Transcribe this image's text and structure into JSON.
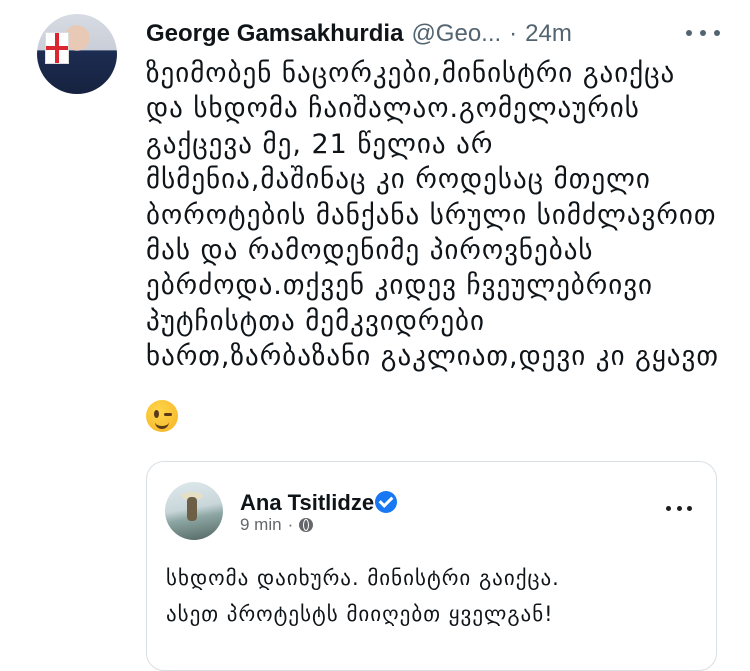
{
  "tweet": {
    "author_name": "George Gamsakhurdia",
    "handle": "@Geo...",
    "separator": "·",
    "time": "24m",
    "text_lines": [
      "ზეიმობენ ნაცორკები,მინისტრი გაიქცა",
      "და სხდომა ჩაიშალაო.გომელაურის",
      "გაქცევა მე, 21 წელია არ",
      "მსმენია,მაშინაც კი როდესაც მთელი",
      "ბოროტების მანქანა სრული სიმძლავრით",
      "მას და რამოდენიმე პიროვნებას",
      "ებრძოდა.თქვენ კიდევ ჩვეულებრივი",
      "პუტჩისტთა მემკვიდრები",
      "ხართ,ზარბაზანი გაკლიათ,დევი კი გყავთ"
    ],
    "emoji": "wink-emoji"
  },
  "quoted_post": {
    "author_name": "Ana Tsitlidze",
    "time": "9 min",
    "separator": "·",
    "text_lines": [
      "სხდომა დაიხურა. მინისტრი გაიქცა.",
      "ასეთ პროტესტს მიიღებთ ყველგან!"
    ]
  }
}
